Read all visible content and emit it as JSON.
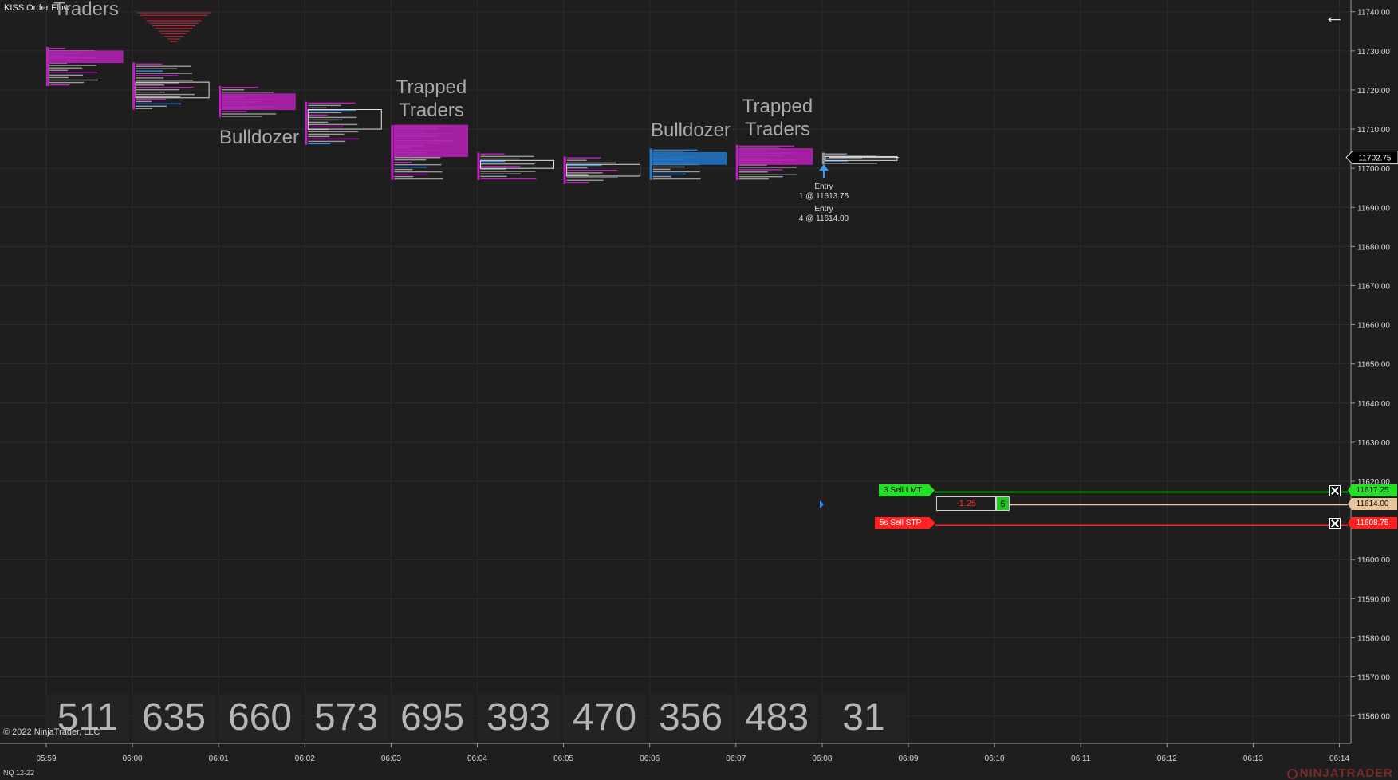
{
  "window": {
    "indicator_name": "KISS Order Flow",
    "copyright": "© 2022 NinjaTrader, LLC",
    "instrument": "NQ 12-22",
    "brand": "NINJATRADER",
    "back_icon": "arrow-left-icon"
  },
  "price_axis": {
    "ticks": [
      "11740.00",
      "11730.00",
      "11720.00",
      "11710.00",
      "11700.00",
      "11690.00",
      "11680.00",
      "11670.00",
      "11660.00",
      "11650.00",
      "11640.00",
      "11630.00",
      "11620.00",
      "11600.00",
      "11590.00",
      "11580.00",
      "11570.00",
      "11560.00"
    ],
    "current_price": "11702.75",
    "min": 11553,
    "max": 11743
  },
  "time_axis": {
    "ticks": [
      "05:59",
      "06:00",
      "06:01",
      "06:02",
      "06:03",
      "06:04",
      "06:05",
      "06:06",
      "06:07",
      "06:08",
      "06:09",
      "06:10",
      "06:11",
      "06:12",
      "06:13",
      "06:14"
    ]
  },
  "annotations": [
    {
      "text": "Traders",
      "line2": ""
    },
    {
      "text": "Bulldozer",
      "line2": ""
    },
    {
      "text": "Trapped",
      "line2": "Traders"
    },
    {
      "text": "Bulldozer",
      "line2": ""
    },
    {
      "text": "Trapped",
      "line2": "Traders"
    }
  ],
  "entries": [
    {
      "label": "Entry",
      "detail": "1 @ 11613.75"
    },
    {
      "label": "Entry",
      "detail": "4 @ 11614.00"
    }
  ],
  "volumes": [
    "511",
    "635",
    "660",
    "573",
    "695",
    "393",
    "470",
    "356",
    "483",
    "31"
  ],
  "orders": {
    "target": {
      "label": "3  Sell LMT",
      "price": "11617.25",
      "price_value": 11617.25,
      "color": "#22e022"
    },
    "position": {
      "pnl": "-1.25",
      "qty": "5",
      "price": "11614.00",
      "price_value": 11614.0,
      "color": "#e8c59a"
    },
    "stop": {
      "label": "5s  Sell STP",
      "price": "11608.75",
      "price_value": 11608.75,
      "color": "#ff2020"
    }
  },
  "chart_data": {
    "type": "bar",
    "title": "",
    "bars": [
      {
        "time": "05:59",
        "high": 11731,
        "low": 11721,
        "color": "#c020c0",
        "box_high": 11730,
        "box_low": 11727,
        "box_fill": "#b01fb0"
      },
      {
        "time": "06:00",
        "high": 11727,
        "low": 11715,
        "color": "#c020c0",
        "box_high": 11722,
        "box_low": 11718,
        "box_fill": "none"
      },
      {
        "time": "06:01",
        "high": 11721,
        "low": 11713,
        "color": "#c020c0",
        "box_high": 11719,
        "box_low": 11715,
        "box_fill": "#b01fb0"
      },
      {
        "time": "06:02",
        "high": 11717,
        "low": 11706,
        "color": "#c020c0",
        "box_high": 11715,
        "box_low": 11710,
        "box_fill": "none"
      },
      {
        "time": "06:03",
        "high": 11711,
        "low": 11697,
        "color": "#c020c0",
        "box_high": 11711,
        "box_low": 11703,
        "box_fill": "#b01fb0"
      },
      {
        "time": "06:04",
        "high": 11704,
        "low": 11697,
        "color": "#c020c0",
        "box_high": 11702,
        "box_low": 11700,
        "box_fill": "none"
      },
      {
        "time": "06:05",
        "high": 11703,
        "low": 11696,
        "color": "#c020c0",
        "box_high": 11701,
        "box_low": 11698,
        "box_fill": "none"
      },
      {
        "time": "06:06",
        "high": 11705,
        "low": 11697,
        "color": "#2080e0",
        "box_high": 11704,
        "box_low": 11701,
        "box_fill": "#2070c0"
      },
      {
        "time": "06:07",
        "high": 11706,
        "low": 11697,
        "color": "#c020c0",
        "box_high": 11705,
        "box_low": 11701,
        "box_fill": "#b01fb0"
      },
      {
        "time": "06:08",
        "high": 11704,
        "low": 11701,
        "color": "#9a9a9a",
        "box_high": 11703,
        "box_low": 11702,
        "box_fill": "none"
      }
    ]
  }
}
